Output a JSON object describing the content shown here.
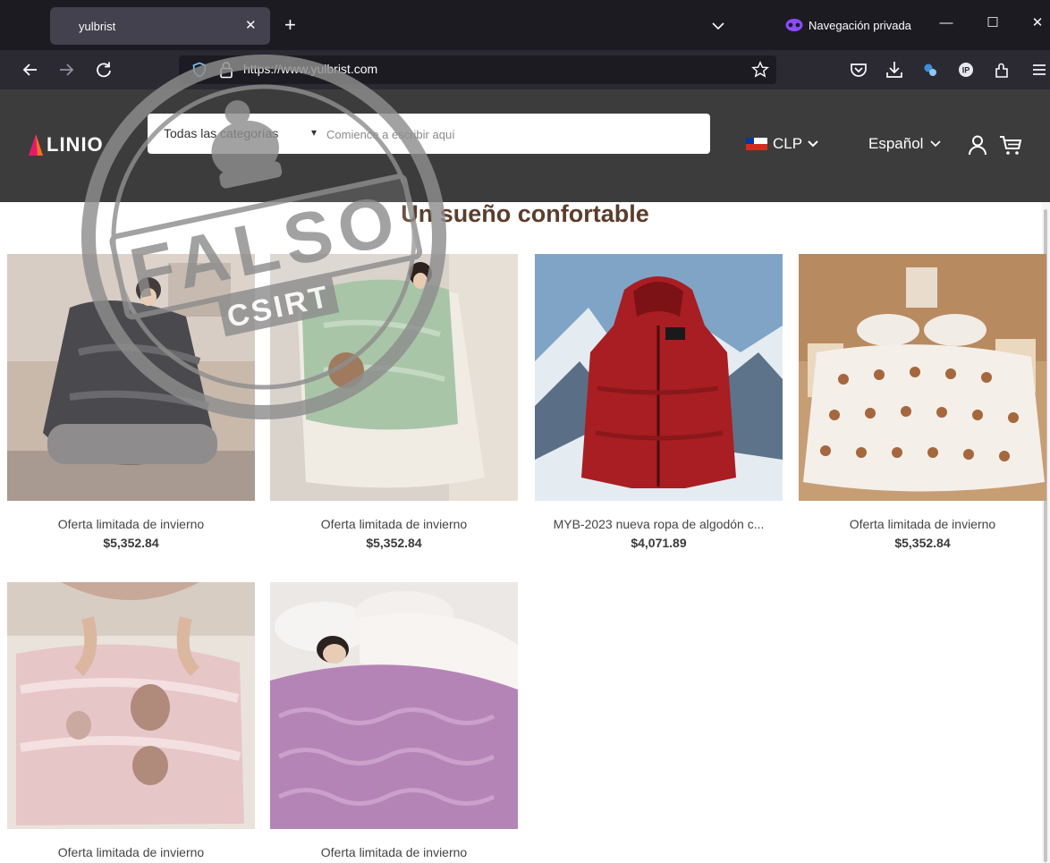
{
  "browser": {
    "tab_title": "yulbrist",
    "tab_close": "✕",
    "new_tab": "+",
    "private_label": "Navegación privada",
    "url_scheme": "https://www.",
    "url_host": "yulbrist.com",
    "window_minimize": "—",
    "window_maximize": "☐",
    "window_close": "✕"
  },
  "site": {
    "logo_text": "LINIO",
    "search": {
      "category": "Todas las categorías",
      "caret": "▾",
      "placeholder": "Comience a escribir aquí"
    },
    "currency": "CLP",
    "language": "Español",
    "dropdown_chevron": "⌄",
    "section_title": "Un sueño confortable"
  },
  "stamp": {
    "word": "FALSO",
    "org": "CSIRT"
  },
  "products": [
    {
      "name": "Oferta limitada de invierno",
      "price": "$5,352.84",
      "image": "gray-comforter-photo"
    },
    {
      "name": "Oferta limitada de invierno",
      "price": "$5,352.84",
      "image": "green-comforter-photo"
    },
    {
      "name": "MYB-2023 nueva ropa de algodón c...",
      "price": "$4,071.89",
      "image": "red-jacket-photo"
    },
    {
      "name": "Oferta limitada de invierno",
      "price": "$5,352.84",
      "image": "bear-comforter-photo"
    },
    {
      "name": "Oferta limitada de invierno",
      "price": "",
      "image": "pink-comforter-photo"
    },
    {
      "name": "Oferta limitada de invierno",
      "price": "",
      "image": "purple-comforter-photo"
    }
  ],
  "colors": {
    "tabbar": "#1c1b22",
    "navbar": "#2b2a33",
    "site_header": "#3d3c3c",
    "title_brown": "#5b3d2c",
    "stamp_gray": "#8e8e8e",
    "logo_pink": "#e7196a",
    "logo_orange": "#f37021"
  }
}
